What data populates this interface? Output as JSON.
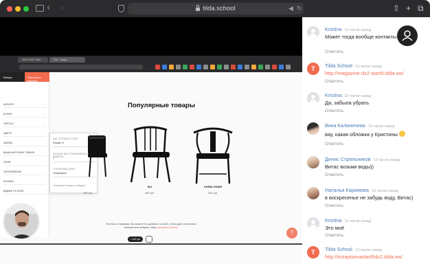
{
  "browser": {
    "url": "tilda.school"
  },
  "video": {
    "inner_tabs": [
      "Test 2019 Tilda",
      "Пот. Товар"
    ],
    "panel_header": {
      "left": "Товары",
      "right": "Оформить магазин"
    },
    "panel_rows": [
      "КАТАЛОГ",
      "БЛОКИ",
      "ТЕКСТЫ",
      "ЦВЕТА",
      "ФАЙЛЫ",
      "ВАШИ КАРТОЧКИ ТОВАРА",
      "ПОЛЯ",
      "ОФОРМЛЕНИЕ",
      "КНОПКИ",
      "ВИДЖЕТ В ПОЛЕ"
    ],
    "dropdown": {
      "label1": "ШАГ ТОРГОВОГО ПОЛЯ",
      "value1": "Режим. Н",
      "label2": "КОЛИЧЕСТВО ОТОБРАЖАЕМЫХ ТОВАРОВ",
      "value2": "3",
      "label3": "СОРТИРОВКА ЦЕНЫ",
      "value3": "Популярное",
      "checkbox": "Отображать товары в слайдере"
    },
    "page_title": "Популярные товары",
    "products": [
      {
        "name": "",
        "price": "190 грн."
      },
      {
        "name": "№1",
        "price": "200 грн."
      },
      {
        "name": "CHINA CHAIR",
        "price": "200 грн."
      }
    ],
    "note_text": "Это блок с товарами. Вы можете его добавить на сайт, чтобы дать посетителю возможность выбрать товар",
    "note_link": "настроить каталог",
    "cart_pill": "= 400 грн",
    "orange_button": "?"
  },
  "chat": {
    "messages": [
      {
        "name": "Kristina",
        "time": "13 часов назад",
        "text": "Может тогда вообще контакты у внизу?",
        "reply": "Ответить",
        "avatar": "generic"
      },
      {
        "name": "Tilda School",
        "time": "13 часов назад",
        "text": "http://magazine-dz2-start5.tilda.ws/",
        "reply": "Ответить",
        "avatar": "tilda",
        "link": true
      },
      {
        "name": "Kristina",
        "time": "13 часов назад",
        "text": "Да, забыла убрать",
        "reply": "Ответить",
        "avatar": "generic"
      },
      {
        "name": "Вика Калиничева",
        "time": "13 часов назад",
        "text": "вау, какая обложка у Кристины",
        "reply": "Ответить",
        "avatar": "photo1",
        "emoji": true
      },
      {
        "name": "Денис Стрельников",
        "time": "13 часов назад",
        "text": "Витас возьми воды))",
        "reply": "Ответить",
        "avatar": "photo2"
      },
      {
        "name": "Наталья Каримова",
        "time": "13 часов назад",
        "text": "в воскресенье не забудь воду, Витас)",
        "reply": "Ответить",
        "avatar": "photo3"
      },
      {
        "name": "Kristina",
        "time": "13 часов назад",
        "text": "Это моё",
        "reply": "Ответить",
        "avatar": "generic"
      },
      {
        "name": "Tilda School",
        "time": "13 часов назад",
        "text": "http://mzaytsevastart5dz2.tilda.ws/",
        "reply": "",
        "avatar": "tilda",
        "link": true
      }
    ]
  }
}
